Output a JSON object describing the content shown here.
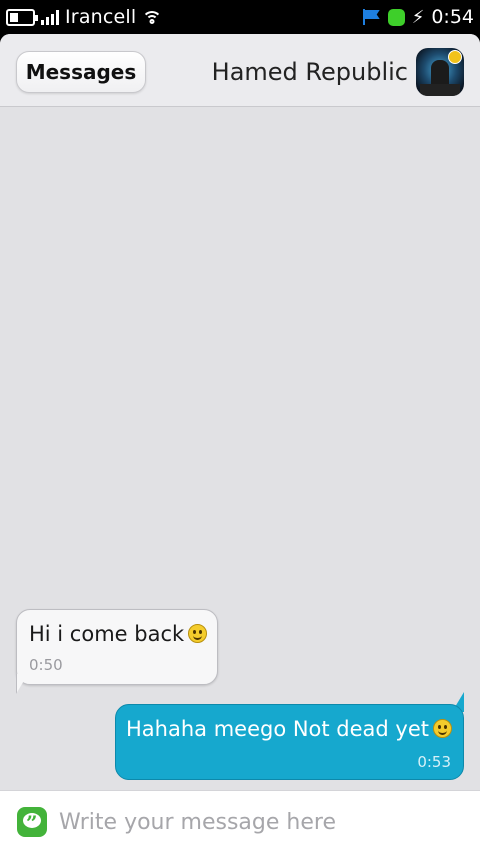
{
  "status_bar": {
    "carrier": "Irancell",
    "time": "0:54",
    "icons": [
      "battery-icon",
      "signal-icon",
      "wifi-icon",
      "flag-icon",
      "presence-icon",
      "usb-icon"
    ],
    "battery_level": 0.25,
    "signal_bars": 4
  },
  "header": {
    "back_label": "Messages",
    "contact_name": "Hamed Republic"
  },
  "messages": [
    {
      "direction": "incoming",
      "text": "Hi i come back",
      "time": "0:50",
      "emoji": "smiley"
    },
    {
      "direction": "outgoing",
      "text": "Hahaha meego Not dead yet",
      "time": "0:53",
      "emoji": "smiley"
    }
  ],
  "composer": {
    "placeholder": "Write your message here",
    "value": ""
  },
  "colors": {
    "outgoing_bubble": "#16a8ce",
    "incoming_bubble": "#f7f7f8",
    "background": "#e1e1e4",
    "presence": "#3ecf2a"
  }
}
